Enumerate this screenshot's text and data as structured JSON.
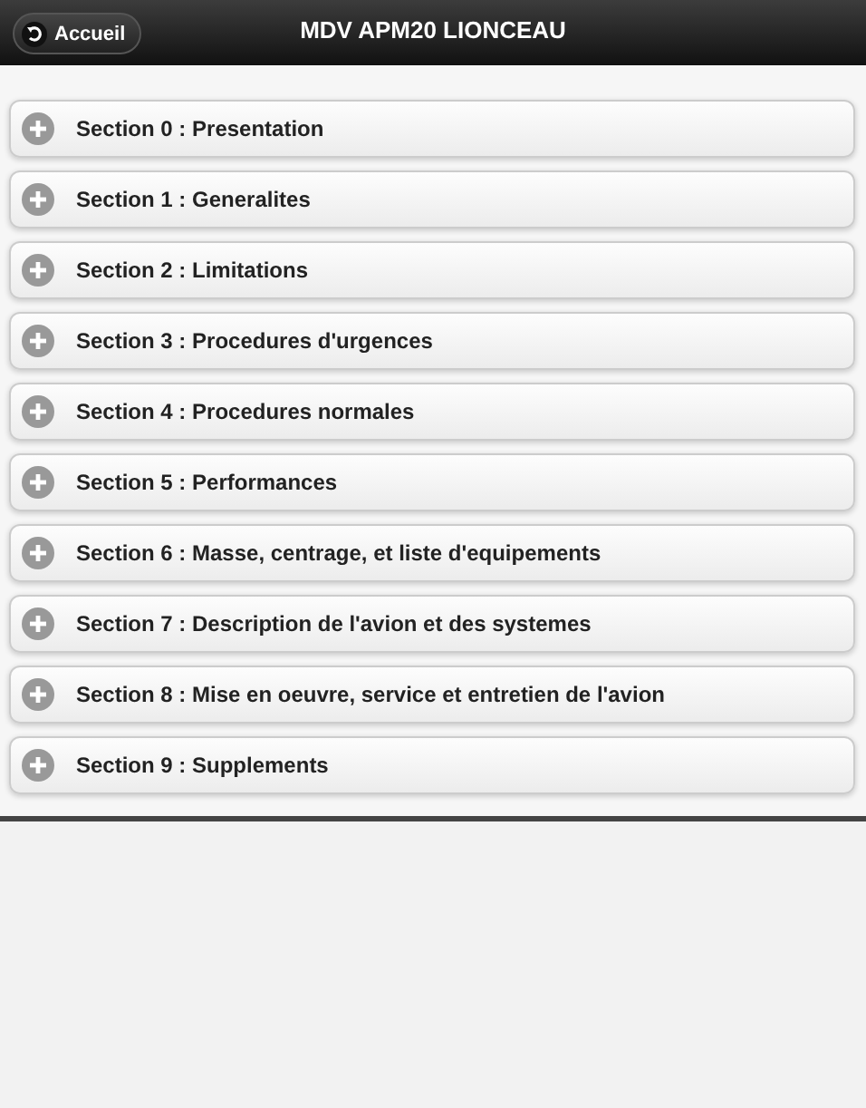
{
  "header": {
    "back_button": "Accueil",
    "title": "MDV APM20 LIONCEAU"
  },
  "sections": [
    {
      "label": "Section 0 : Presentation",
      "expanded": false
    },
    {
      "label": "Section 1 : Generalites",
      "expanded": false
    },
    {
      "label": "Section 2 : Limitations",
      "expanded": false
    },
    {
      "label": "Section 3 : Procedures d'urgences",
      "expanded": false
    },
    {
      "label": "Section 4 : Procedures normales",
      "expanded": false
    },
    {
      "label": "Section 5 : Performances",
      "expanded": false
    },
    {
      "label": "Section 6 : Masse, centrage, et liste d'equipements",
      "expanded": false
    },
    {
      "label": "Section 7 : Description de l'avion et des systemes",
      "expanded": false
    },
    {
      "label": "Section 8 : Mise en oeuvre, service et entretien de l'avion",
      "expanded": false
    },
    {
      "label": "Section 9 : Supplements",
      "expanded": false
    }
  ]
}
